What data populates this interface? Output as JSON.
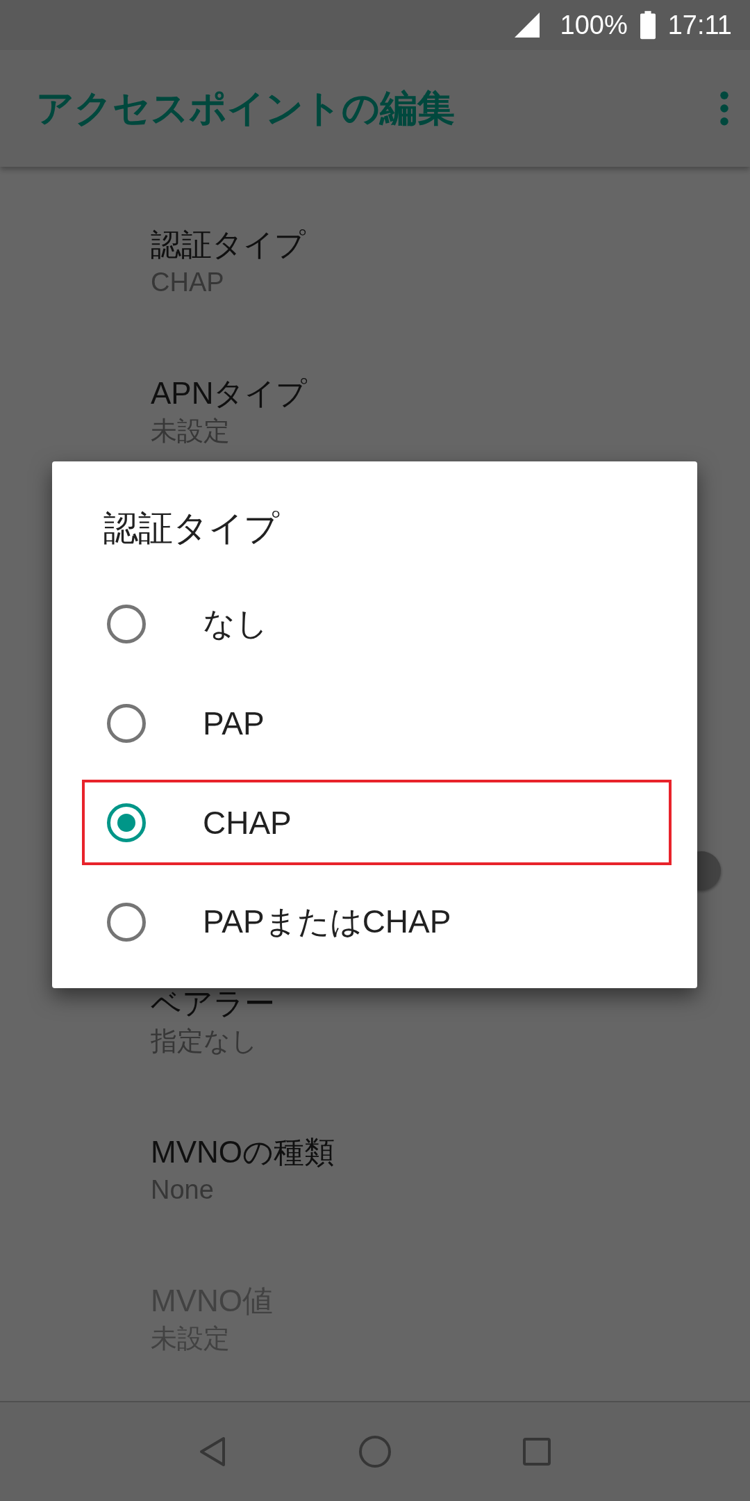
{
  "status_bar": {
    "battery": "100%",
    "time": "17:11"
  },
  "app_bar": {
    "title": "アクセスポイントの編集"
  },
  "settings_above": [
    {
      "title": "認証タイプ",
      "summary": "CHAP",
      "disabled": false
    },
    {
      "title": "APNタイプ",
      "summary": "未設定",
      "disabled": false
    }
  ],
  "settings_below": [
    {
      "title": "ベアラー",
      "summary": "指定なし",
      "disabled": false
    },
    {
      "title": "MVNOの種類",
      "summary": "None",
      "disabled": false
    },
    {
      "title": "MVNO値",
      "summary": "未設定",
      "disabled": true
    }
  ],
  "dialog": {
    "title": "認証タイプ",
    "options": [
      {
        "label": "なし",
        "selected": false,
        "highlighted": false
      },
      {
        "label": "PAP",
        "selected": false,
        "highlighted": false
      },
      {
        "label": "CHAP",
        "selected": true,
        "highlighted": true
      },
      {
        "label": "PAPまたはCHAP",
        "selected": false,
        "highlighted": false
      }
    ]
  }
}
